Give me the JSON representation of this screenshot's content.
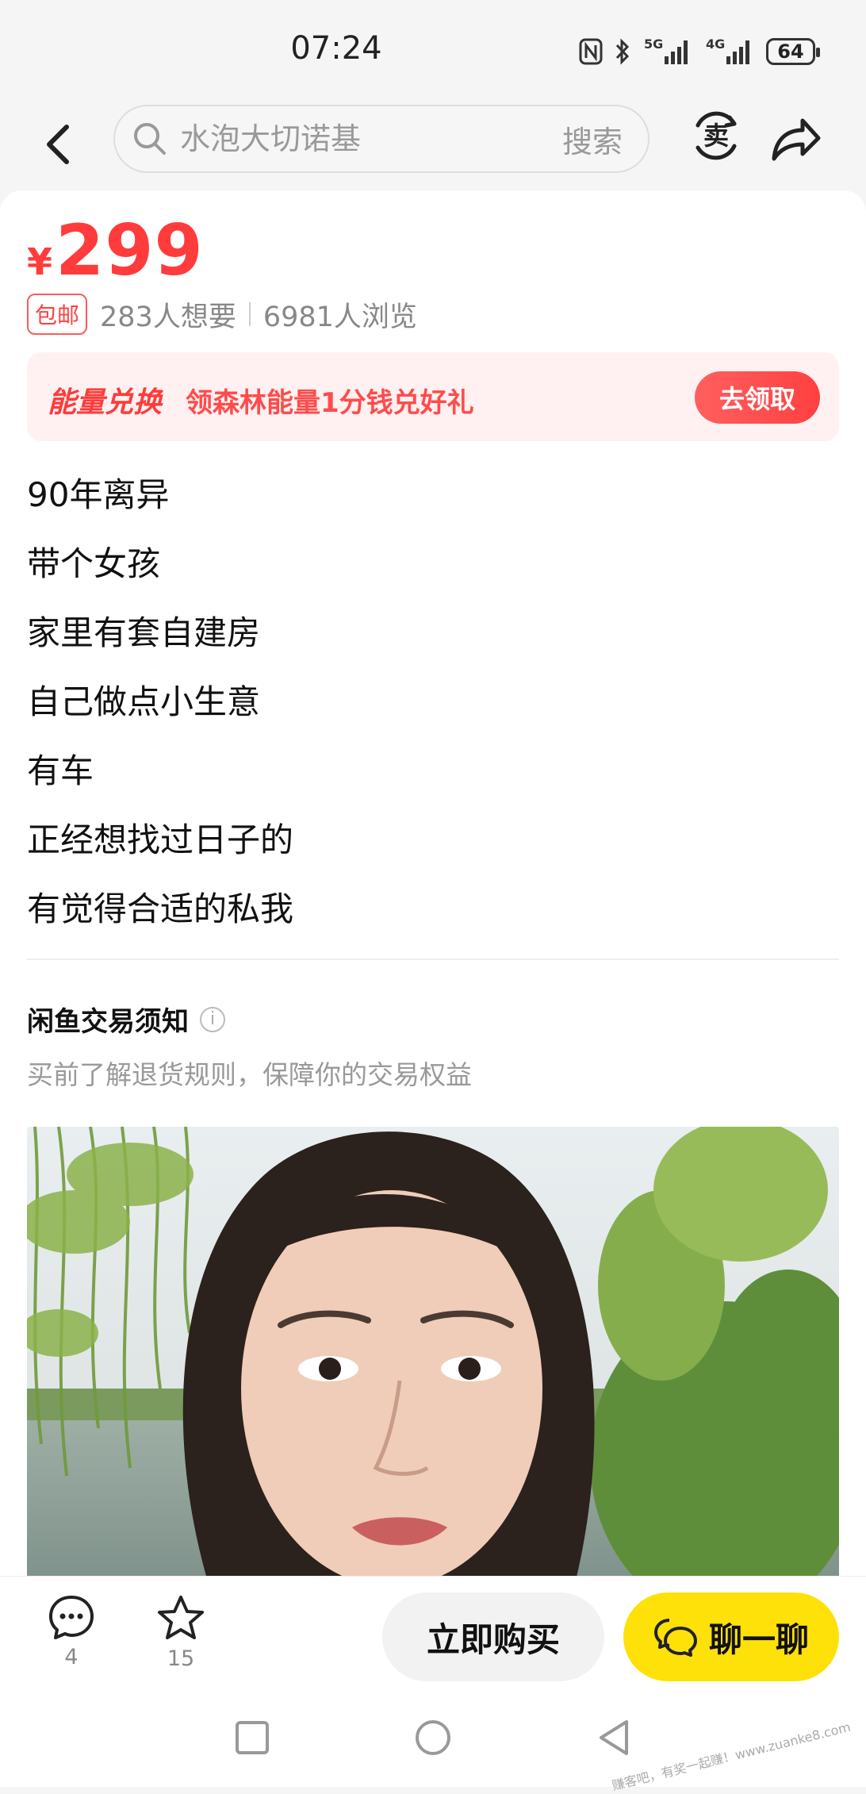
{
  "status_bar": {
    "time": "07:24",
    "battery": "64"
  },
  "search": {
    "placeholder": "水泡大切诺基",
    "button": "搜索"
  },
  "sell_label": "卖",
  "listing": {
    "currency": "¥",
    "price": "299",
    "shipping_tag": "包邮",
    "wants": "283人想要",
    "views": "6981人浏览"
  },
  "promo": {
    "title": "能量兑换",
    "desc": "领森林能量1分钱兑好礼",
    "button": "去领取"
  },
  "description": [
    "90年离异",
    "带个女孩",
    "家里有套自建房",
    "自己做点小生意",
    "有车",
    "正经想找过日子的",
    "有觉得合适的私我"
  ],
  "notice": {
    "title": "闲鱼交易须知",
    "subtitle": "买前了解退货规则，保障你的交易权益"
  },
  "actions": {
    "comments_count": "4",
    "favorites_count": "15",
    "buy_now": "立即购买",
    "chat": "聊一聊"
  },
  "watermark": "赚客吧，有奖一起赚！www.zuanke8.com",
  "colors": {
    "price": "#ff3b3b",
    "accent_yellow": "#ffe10a",
    "promo_bg": "#fff1f1"
  }
}
